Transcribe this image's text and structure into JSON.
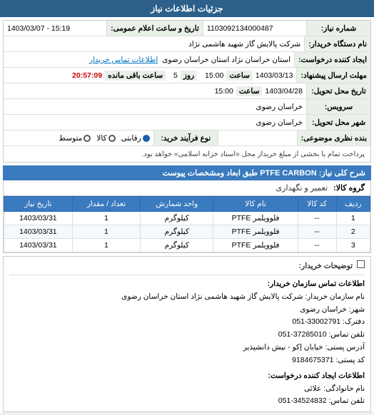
{
  "header": {
    "title": "جزئیات اطلاعات نیاز"
  },
  "fields": {
    "shomareNiaz_label": "شماره نیاز:",
    "shomareNiaz_value": "1103092134000487",
    "dateTime_label": "تاریخ و ساعت اعلام عمومی:",
    "dateTime_value": "1403/03/07 - 15:19",
    "namDastgahKharid_label": "نام دستگاه خریدار:",
    "namDastgahKharid_value": "شرکت پالایش گاز شهید هاشمی نژاد",
    "eijadKonande_label": "ایجاد کننده درخواست:",
    "eijadKonande_value": "استان خراسان نژاد   استان خراسان رضوی",
    "eijadKonande_link": "اطلاعات تماس خریدار",
    "mohlat_label": "مهلت ارسال پیشنهاد:",
    "mohlat_date": "1403/03/13",
    "mohlat_saat_label": "ساعت",
    "mohlat_saat_value": "15:00",
    "mohlat_rooz_label": "روز",
    "mohlat_rooz_value": "5",
    "mohlat_baqi_label": "ساعت باقی مانده",
    "mohlat_baqi_value": "20:57:09",
    "tarikhEtebaar_label": "تاریخ محل تحویل:",
    "tarikhEtebaar_date": "1403/04/28",
    "tarikhEtebaar_saat": "15:00",
    "servises_label": "سرویس:",
    "servises_value": "خراسان رضوی",
    "shahre_label": "شهر محل تحویل:",
    "shahre_value": "خراسان رضوی",
    "bandeNazari_label": "بنده نظری موضوعی:",
    "naveTarid_label": "نوع فرآیند خرید:",
    "naveTarid_options": [
      "رقابتی",
      "کالا",
      "متوسط"
    ],
    "naveTarid_selected": "رقابتی",
    "tarid_note": "پرداخت تمام یا بخشی از مبلغ خریداز محل «اسناد خزانه اسلامی» خواهد بود."
  },
  "product_section": {
    "title": "شرح کلی نیاز: PTFE CARBON طبق ابعاد ومشخصات پیوست",
    "group_label": "گروه کالا:",
    "group_value": "تعمیر و نگهداری",
    "table": {
      "headers": [
        "ردیف",
        "کد کالا",
        "نام کالا",
        "واحد شمارش",
        "تعداد / مقدار",
        "تاریخ نیاز"
      ],
      "rows": [
        {
          "row": "1",
          "code": "--",
          "name": "فلوویلمر PTFE",
          "unit": "کیلوگرم",
          "qty": "1",
          "date": "1403/03/31"
        },
        {
          "row": "2",
          "code": "--",
          "name": "فلوویلمر PTFE",
          "unit": "کیلوگرم",
          "qty": "1",
          "date": "1403/03/31"
        },
        {
          "row": "3",
          "code": "--",
          "name": "فلوویلمر PTFE",
          "unit": "کیلوگرم",
          "qty": "1",
          "date": "1403/03/31"
        }
      ]
    }
  },
  "notes": {
    "title": "توضیحات خریدار:",
    "checkbox_label": "",
    "contact_title": "اطلاعات تماس سازمان خریدار:",
    "nam_sazman": "نام سازمان خریدار: شرکت پالایش گاز شهید هاشمی نژاد استان خراسان رضوی",
    "shahre_sazman": "شهر: خراسان رضوی",
    "daftare": "دفترک: 33002791-051",
    "telphone": "تلفن تماس: 37285010-051",
    "address": "آدرس پستی: خیابان اِکو - نیش دانشپذیر",
    "postal": "کد پستی: 9184675371",
    "contact_kharid_title": "اطلاعات ایجاد کننده درخواست:",
    "nam_kharid": "نام حانوادگی: علائی",
    "telphone_kharid": "تلفن تماس: 34524832-051"
  }
}
